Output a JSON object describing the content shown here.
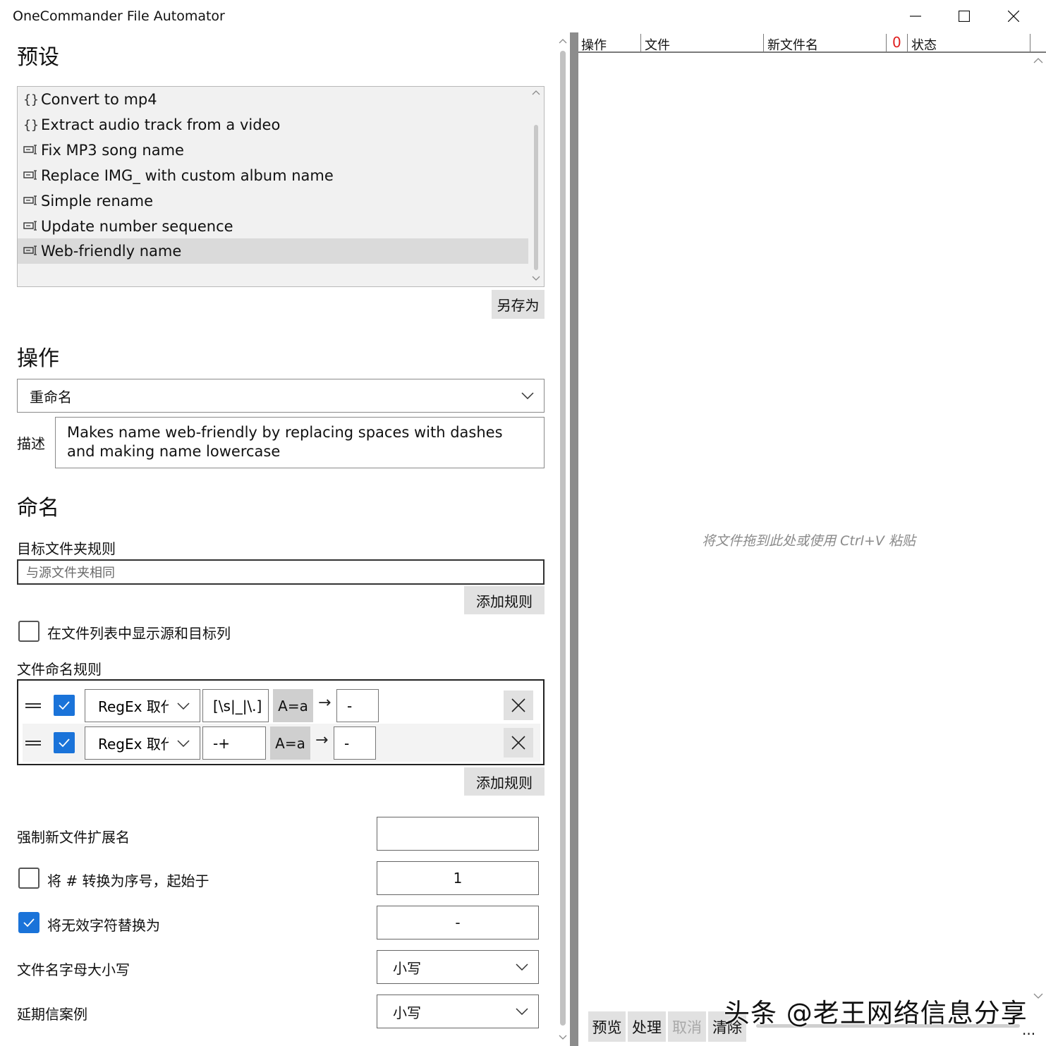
{
  "window": {
    "title": "OneCommander File Automator"
  },
  "presets": {
    "heading": "预设",
    "items": [
      {
        "icon": "{}",
        "label": "Convert to mp4"
      },
      {
        "icon": "{}",
        "label": "Extract audio track from a video"
      },
      {
        "icon": "rename-icon",
        "label": "Fix MP3 song name"
      },
      {
        "icon": "rename-icon",
        "label": "Replace IMG_ with custom album name"
      },
      {
        "icon": "rename-icon",
        "label": "Simple rename"
      },
      {
        "icon": "rename-icon",
        "label": "Update number sequence"
      },
      {
        "icon": "rename-icon",
        "label": "Web-friendly name",
        "selected": true
      }
    ],
    "save_as_label": "另存为"
  },
  "operation": {
    "heading": "操作",
    "selected": "重命名",
    "description_label": "描述",
    "description": "Makes name web-friendly by replacing spaces with dashes and making name lowercase"
  },
  "naming": {
    "heading": "命名",
    "target_folder_label": "目标文件夹规则",
    "target_folder_placeholder": "与源文件夹相同",
    "add_rule_label": "添加规则",
    "show_source_target_label": "在文件列表中显示源和目标列",
    "show_source_target_checked": false,
    "file_rules_label": "文件命名规则",
    "rules": [
      {
        "enabled": true,
        "type": "RegEx 取代",
        "pattern": "[\\s|_|\\.]",
        "case": "A=a",
        "arrow": "→",
        "replace": "-"
      },
      {
        "enabled": true,
        "type": "RegEx 取代",
        "pattern": "-+",
        "case": "A=a",
        "arrow": "→",
        "replace": "-"
      }
    ],
    "add_rule_label_2": "添加规则",
    "force_ext_label": "强制新文件扩展名",
    "force_ext_value": "",
    "hash_to_seq_label": "将 # 转换为序号，起始于",
    "hash_to_seq_checked": false,
    "hash_to_seq_value": "1",
    "replace_invalid_label": "将无效字符替换为",
    "replace_invalid_checked": true,
    "replace_invalid_value": "-",
    "case_label": "文件名字母大小写",
    "case_value": "小写",
    "ext_case_label": "延期信案例",
    "ext_case_value": "小写"
  },
  "file_list": {
    "columns": [
      "操作",
      "文件",
      "新文件名",
      "状态"
    ],
    "count": "0",
    "empty_hint": "将文件拖到此处或使用 Ctrl+V 粘贴"
  },
  "actions": {
    "preview": "预览",
    "process": "处理",
    "cancel": "取消",
    "clear": "清除",
    "overflow": "..."
  },
  "watermark": "头条 @老王网络信息分享",
  "colors": {
    "accent": "#1a73d9",
    "count": "#e02020",
    "button_bg": "#e1e1e1"
  }
}
